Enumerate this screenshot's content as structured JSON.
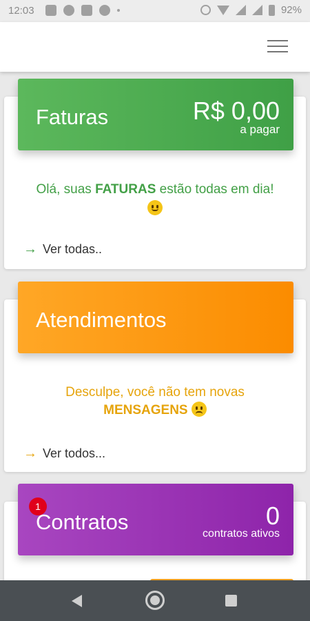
{
  "status_bar": {
    "time": "12:03",
    "battery": "92%",
    "icons_left": [
      "news-icon",
      "notification-icon",
      "phone-icon",
      "globe-icon",
      "dot-icon"
    ],
    "icons_right": [
      "alarm-icon",
      "wifi-icon",
      "signal-icon",
      "signal-icon",
      "battery-icon"
    ]
  },
  "app_bar": {
    "menu_icon": "hamburger-menu-icon"
  },
  "cards": {
    "faturas": {
      "title": "Faturas",
      "amount": "R$ 0,00",
      "amount_label": "a pagar",
      "message_before": "Olá, suas ",
      "message_highlight": "FATURAS",
      "message_after": " estão todas em dia!",
      "emoji": "wink-face-icon",
      "link": "Ver todas..",
      "color_from": "#5cb85c",
      "color_to": "#3fa046",
      "text_color": "#43a047"
    },
    "atendimentos": {
      "title": "Atendimentos",
      "message_line1": "Desculpe, você não tem novas",
      "message_highlight": "MENSAGENS",
      "emoji": "sad-face-icon",
      "link": "Ver todos...",
      "color_from": "#ffa726",
      "color_to": "#fb8c00",
      "text_color": "#e6a40c"
    },
    "contratos": {
      "title": "Contratos",
      "badge": "1",
      "count": "0",
      "count_label": "contratos ativos",
      "color_from": "#a846c0",
      "color_to": "#8e24aa"
    }
  },
  "nav_bar": {
    "back_icon": "back-icon",
    "home_icon": "home-icon",
    "recents_icon": "recents-icon"
  }
}
